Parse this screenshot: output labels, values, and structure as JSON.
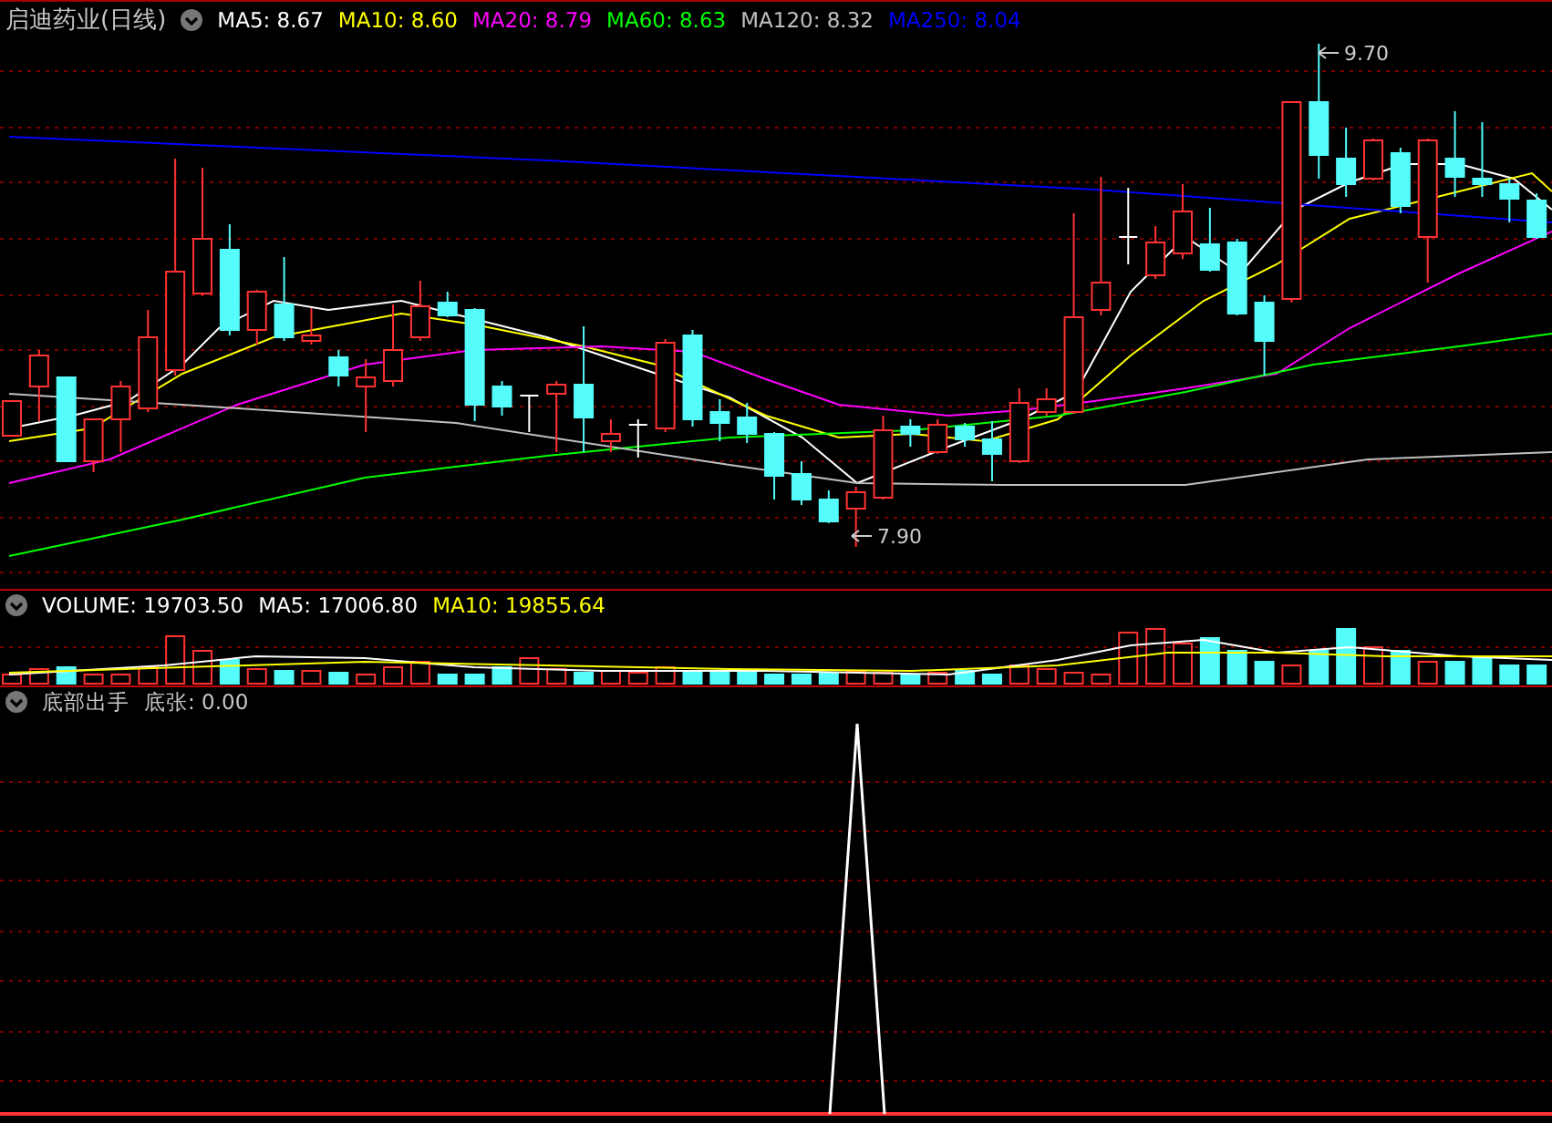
{
  "title": "启迪药业(日线)",
  "price_legend": [
    {
      "label": "MA5:",
      "value": "8.67",
      "color": "#ffffff"
    },
    {
      "label": "MA10:",
      "value": "8.60",
      "color": "#ffff00"
    },
    {
      "label": "MA20:",
      "value": "8.79",
      "color": "#ff00ff"
    },
    {
      "label": "MA60:",
      "value": "8.63",
      "color": "#00ff00"
    },
    {
      "label": "MA120:",
      "value": "8.32",
      "color": "#c0c0c0"
    },
    {
      "label": "MA250:",
      "value": "8.04",
      "color": "#0000ff"
    }
  ],
  "price_annotations": [
    {
      "kind": "high",
      "text": "9.70"
    },
    {
      "kind": "low",
      "text": "7.90"
    }
  ],
  "volume_legend": [
    {
      "label": "VOLUME:",
      "value": "19703.50",
      "color": "#ffffff"
    },
    {
      "label": "MA5:",
      "value": "17006.80",
      "color": "#ffffff"
    },
    {
      "label": "MA10:",
      "value": "19855.64",
      "color": "#ffff00"
    }
  ],
  "indicator_legend": {
    "name": "底部出手",
    "label": "底张:",
    "value": "0.00"
  }
}
